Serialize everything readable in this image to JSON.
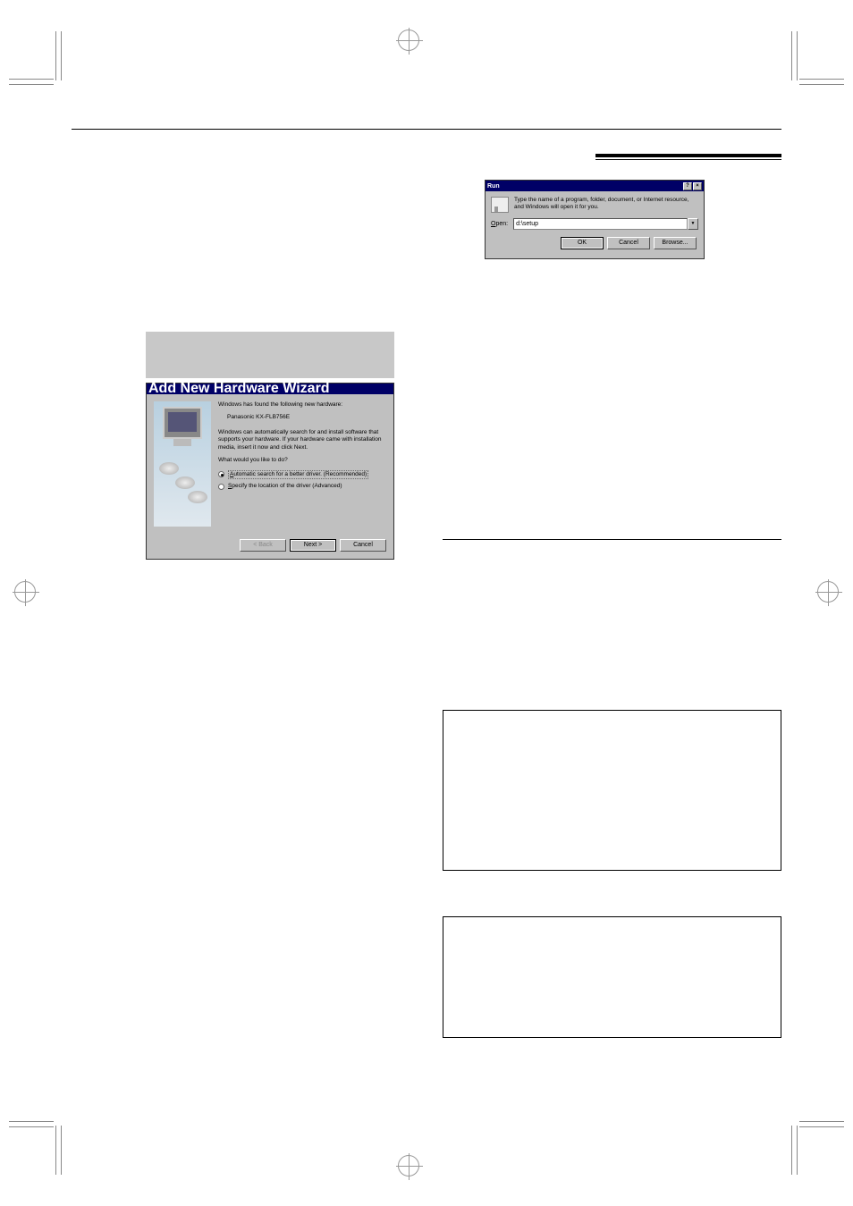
{
  "run_dialog": {
    "title": "Run",
    "help_btn": "?",
    "close_btn": "×",
    "description": "Type the name of a program, folder, document, or Internet resource, and Windows will open it for you.",
    "open_label_letter": "O",
    "open_label_rest": "pen:",
    "open_value": "d:\\setup",
    "buttons": {
      "ok": "OK",
      "cancel": "Cancel",
      "browse": "Browse..."
    }
  },
  "wizard": {
    "title": "Add New Hardware Wizard",
    "line1": "Windows has found the following new hardware:",
    "device": "Panasonic KX-FLB756E",
    "line2": "Windows can automatically search for and install software that supports your hardware. If your hardware came with installation media, insert it now and click Next.",
    "question": "What would you like to do?",
    "opt1_letter": "A",
    "opt1_rest": "utomatic search for a better driver. (Recommended)",
    "opt2_letter": "S",
    "opt2_rest": "pecify the location of the driver (Advanced)",
    "back": "< Back",
    "next": "Next >",
    "cancel": "Cancel"
  }
}
